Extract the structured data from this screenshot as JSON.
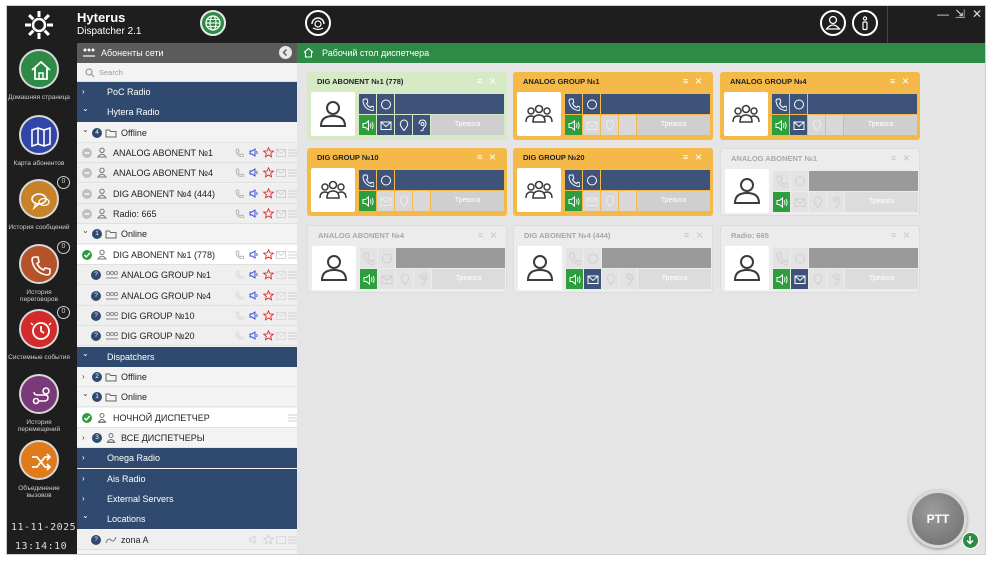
{
  "app": {
    "title": "Hyterus",
    "subtitle": "Dispatcher  2.1"
  },
  "window": {
    "minimize": "—",
    "restore": "⇲",
    "close": "✕"
  },
  "rail": {
    "items": [
      {
        "label": "Домашняя страница",
        "icon": "home-icon",
        "color": "#2e8b47",
        "badge": ""
      },
      {
        "label": "Карта абонентов",
        "icon": "map-icon",
        "color": "#3146a8",
        "badge": ""
      },
      {
        "label": "История сообщений",
        "icon": "chat-icon",
        "color": "#c8832a",
        "badge": "0"
      },
      {
        "label": "История переговоров",
        "icon": "phone-icon",
        "color": "#b5522a",
        "badge": "0"
      },
      {
        "label": "Системные события",
        "icon": "clock-alert-icon",
        "color": "#d42a2a",
        "badge": "0"
      },
      {
        "label": "История перемещений",
        "icon": "route-icon",
        "color": "#7a3a7a",
        "badge": ""
      },
      {
        "label": "Объединение вызовов",
        "icon": "shuffle-icon",
        "color": "#e07a1a",
        "badge": ""
      }
    ],
    "date": "11-11-2025",
    "time": "13:14:10"
  },
  "tree": {
    "header": "Абоненты сети",
    "search_placeholder": "Search",
    "rows": [
      {
        "kind": "cat",
        "label": "PoC Radio",
        "chev": ">"
      },
      {
        "kind": "cat",
        "label": "Hytera Radio",
        "chev": "v"
      },
      {
        "kind": "grp",
        "label": "Offline",
        "count": "4",
        "chev": "v"
      },
      {
        "kind": "item",
        "label": "ANALOG ABONENT №1",
        "status": "gray",
        "icon": "person",
        "star": "red",
        "phone": true
      },
      {
        "kind": "item",
        "label": "ANALOG ABONENT №4",
        "status": "gray",
        "icon": "person",
        "star": "red",
        "phone": true
      },
      {
        "kind": "item",
        "label": "DIG ABONENT  №4 (444)",
        "status": "gray",
        "icon": "person",
        "star": "red",
        "phone": true
      },
      {
        "kind": "item",
        "label": "Radio: 665",
        "status": "gray",
        "icon": "person",
        "star": "red",
        "phone": true
      },
      {
        "kind": "grp",
        "label": "Online",
        "count": "1",
        "chev": "v"
      },
      {
        "kind": "itemw",
        "label": "DIG ABONENT  №1 (778)",
        "status": "green",
        "icon": "person",
        "star": "red",
        "phone": true
      },
      {
        "kind": "item",
        "label": "ANALOG GROUP №1",
        "status": "navy",
        "icon": "group",
        "star": "red",
        "phone": false
      },
      {
        "kind": "item",
        "label": "ANALOG GROUP №4",
        "status": "navy",
        "icon": "group",
        "star": "red",
        "phone": false
      },
      {
        "kind": "item",
        "label": "DIG GROUP №10",
        "status": "navy",
        "icon": "group",
        "star": "red",
        "phone": false
      },
      {
        "kind": "item",
        "label": "DIG GROUP №20",
        "status": "navy",
        "icon": "group",
        "star": "red",
        "phone": false
      },
      {
        "kind": "cat",
        "label": "Dispatchers",
        "chev": "v"
      },
      {
        "kind": "grp",
        "label": "Offline",
        "count": "2",
        "chev": ">"
      },
      {
        "kind": "grp",
        "label": "Online",
        "count": "1",
        "chev": "v"
      },
      {
        "kind": "itemw",
        "label": "НОЧНОЙ ДИСПЕТЧЕР",
        "status": "green",
        "icon": "dispatcher",
        "star": "",
        "phone": false
      },
      {
        "kind": "grp",
        "label": "ВСЕ ДИСПЕТЧЕРЫ",
        "count": "3",
        "chev": ">"
      },
      {
        "kind": "cat",
        "label": "Onega Radio",
        "chev": ">"
      },
      {
        "kind": "cat",
        "label": "Ais Radio",
        "chev": ">"
      },
      {
        "kind": "cat",
        "label": "External Servers",
        "chev": ">"
      },
      {
        "kind": "cat",
        "label": "Locations",
        "chev": "v"
      },
      {
        "kind": "item",
        "label": "zona A",
        "status": "navy",
        "icon": "zone",
        "star": "",
        "phone": false
      }
    ]
  },
  "main": {
    "header": "Рабочий стол диспетчера",
    "alarm_label": "Тревога",
    "cards": [
      {
        "title": "DIG ABONENT  №1 (778)",
        "state": "online-person",
        "avatar": "person"
      },
      {
        "title": "ANALOG GROUP №1",
        "state": "group",
        "avatar": "group"
      },
      {
        "title": "ANALOG GROUP №4",
        "state": "group",
        "avatar": "group"
      },
      {
        "title": "DIG GROUP №10",
        "state": "group",
        "avatar": "group"
      },
      {
        "title": "DIG GROUP №20",
        "state": "group",
        "avatar": "group"
      },
      {
        "title": "ANALOG ABONENT №1",
        "state": "offline",
        "avatar": "person"
      },
      {
        "title": "ANALOG ABONENT №4",
        "state": "offline",
        "avatar": "person"
      },
      {
        "title": "DIG ABONENT  №4 (444)",
        "state": "offline",
        "avatar": "person"
      },
      {
        "title": "Radio: 665",
        "state": "offline",
        "avatar": "person"
      }
    ]
  },
  "ptt": {
    "label": "PTT"
  },
  "colors": {
    "green": "#2e8b47",
    "navy": "#2f4a6e",
    "amber": "#f5b94a",
    "lightgreen": "#d9ecc9",
    "cardgray": "#ececec"
  }
}
